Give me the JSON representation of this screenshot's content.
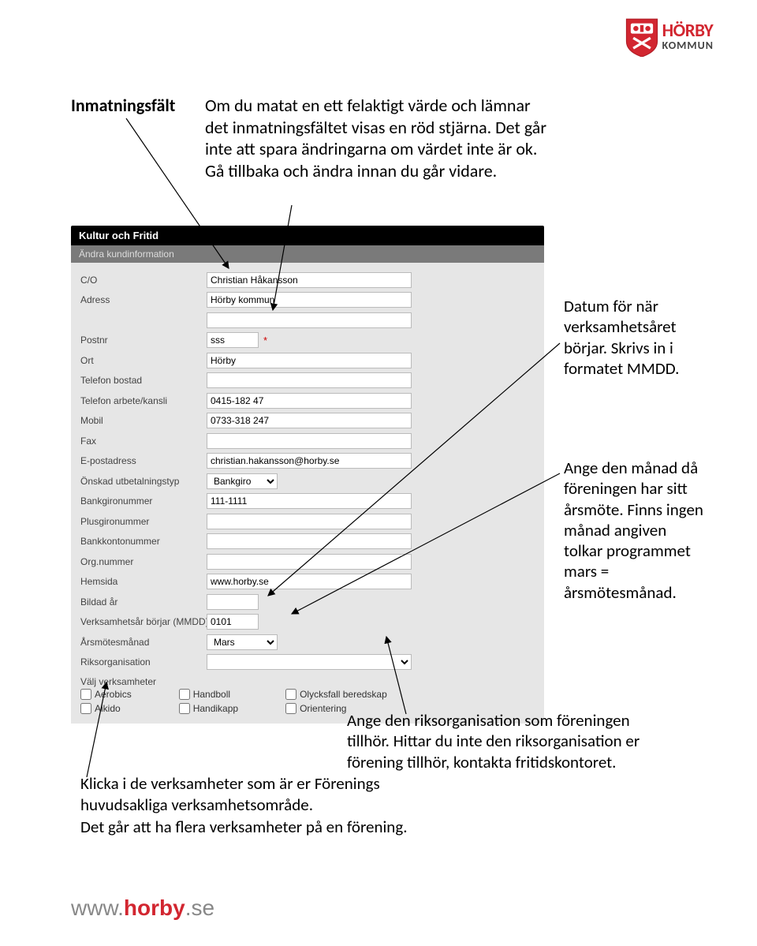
{
  "logo": {
    "top": "HÖRBY",
    "bot": "KOMMUN"
  },
  "intro": {
    "label": "Inmatningsfält",
    "body": "Om du matat en ett felaktigt värde och lämnar det inmatningsfältet visas en röd stjärna. Det går inte att spara ändringarna om värdet inte är ok. Gå tillbaka och ändra innan du går vidare."
  },
  "form": {
    "header": "Kultur och Fritid",
    "sub": "Ändra kundinformation",
    "rows": {
      "co": {
        "label": "C/O",
        "value": "Christian Håkansson"
      },
      "adress": {
        "label": "Adress",
        "value": "Hörby kommun"
      },
      "adress2": {
        "label": "",
        "value": ""
      },
      "postnr": {
        "label": "Postnr",
        "value": "sss"
      },
      "ort": {
        "label": "Ort",
        "value": "Hörby"
      },
      "tel_bostad": {
        "label": "Telefon bostad",
        "value": ""
      },
      "tel_arbete": {
        "label": "Telefon arbete/kansli",
        "value": "0415-182 47"
      },
      "mobil": {
        "label": "Mobil",
        "value": "0733-318 247"
      },
      "fax": {
        "label": "Fax",
        "value": ""
      },
      "epost": {
        "label": "E-postadress",
        "value": "christian.hakansson@horby.se"
      },
      "utbet": {
        "label": "Önskad utbetalningstyp",
        "value": "Bankgiro"
      },
      "bankgiro": {
        "label": "Bankgironummer",
        "value": "111-1111"
      },
      "plusgiro": {
        "label": "Plusgironummer",
        "value": ""
      },
      "bankkonto": {
        "label": "Bankkontonummer",
        "value": ""
      },
      "orgnr": {
        "label": "Org.nummer",
        "value": ""
      },
      "hemsida": {
        "label": "Hemsida",
        "value": "www.horby.se"
      },
      "bildad": {
        "label": "Bildad år",
        "value": ""
      },
      "verkborjar": {
        "label": "Verksamhetsår börjar (MMDD)",
        "value": "0101"
      },
      "arsmote": {
        "label": "Årsmötesmånad",
        "value": "Mars"
      },
      "riksorg": {
        "label": "Riksorganisation",
        "value": ""
      }
    },
    "checks_label": "Välj verksamheter",
    "checks": {
      "col1": [
        "Aerobics",
        "Aikido"
      ],
      "col2": [
        "Handboll",
        "Handikapp"
      ],
      "col3": [
        "Olycksfall beredskap",
        "Orientering"
      ]
    }
  },
  "callout1": "Datum för när verksamhetsåret börjar. Skrivs in i formatet MMDD.",
  "callout2": "Ange den månad då föreningen har sitt årsmöte. Finns ingen månad angiven tolkar programmet mars = årsmötesmånad.",
  "callout3": "Ange den riksorganisation som föreningen tillhör. Hittar du inte den riksorganisation er förening tillhör, kontakta fritidskontoret.",
  "bottom": "Klicka i de verksamheter som är er Förenings huvudsakliga verksamhetsområde.\nDet går att ha flera verksamheter på en förening.",
  "footer": {
    "www": "www.",
    "horby": "horby",
    "se": ".se"
  }
}
